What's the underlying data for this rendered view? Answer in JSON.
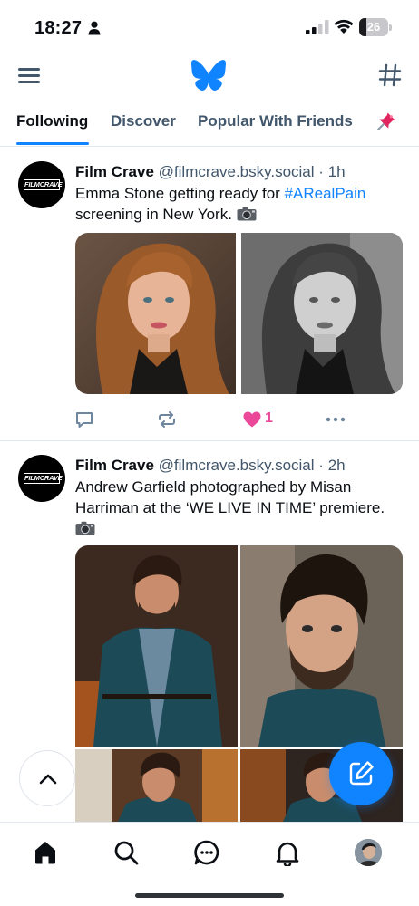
{
  "status_bar": {
    "time": "18:27",
    "battery": "26",
    "battery_level": 0.26
  },
  "header": {
    "menu_icon": "hamburger-menu-icon",
    "logo_icon": "butterfly-logo-icon",
    "feeds_icon": "hashtag-icon"
  },
  "tabs": [
    {
      "label": "Following",
      "active": true
    },
    {
      "label": "Discover",
      "active": false
    },
    {
      "label": "Popular With Friends",
      "active": false
    }
  ],
  "pin_icon": "pin-icon",
  "posts": [
    {
      "author": "Film Crave",
      "handle": "@filmcrave.bsky.social",
      "dot": "·",
      "time": "1h",
      "avatar_label": "FILMCRAVE",
      "text_before": "Emma Stone getting ready for ",
      "hashtag": "#ARealPain",
      "text_after": "screening in New York.",
      "like_count": "1",
      "liked": true
    },
    {
      "author": "Film Crave",
      "handle": "@filmcrave.bsky.social",
      "dot": "·",
      "time": "2h",
      "avatar_label": "FILMCRAVE",
      "text": "Andrew Garfield photographed by Misan Harriman at the ‘WE LIVE IN TIME’ premiere."
    }
  ],
  "colors": {
    "accent": "#1083fe",
    "like": "#ec4899",
    "muted": "#42576c"
  },
  "bottom_nav": [
    "home-icon",
    "search-icon",
    "chat-icon",
    "bell-icon",
    "profile-avatar"
  ]
}
